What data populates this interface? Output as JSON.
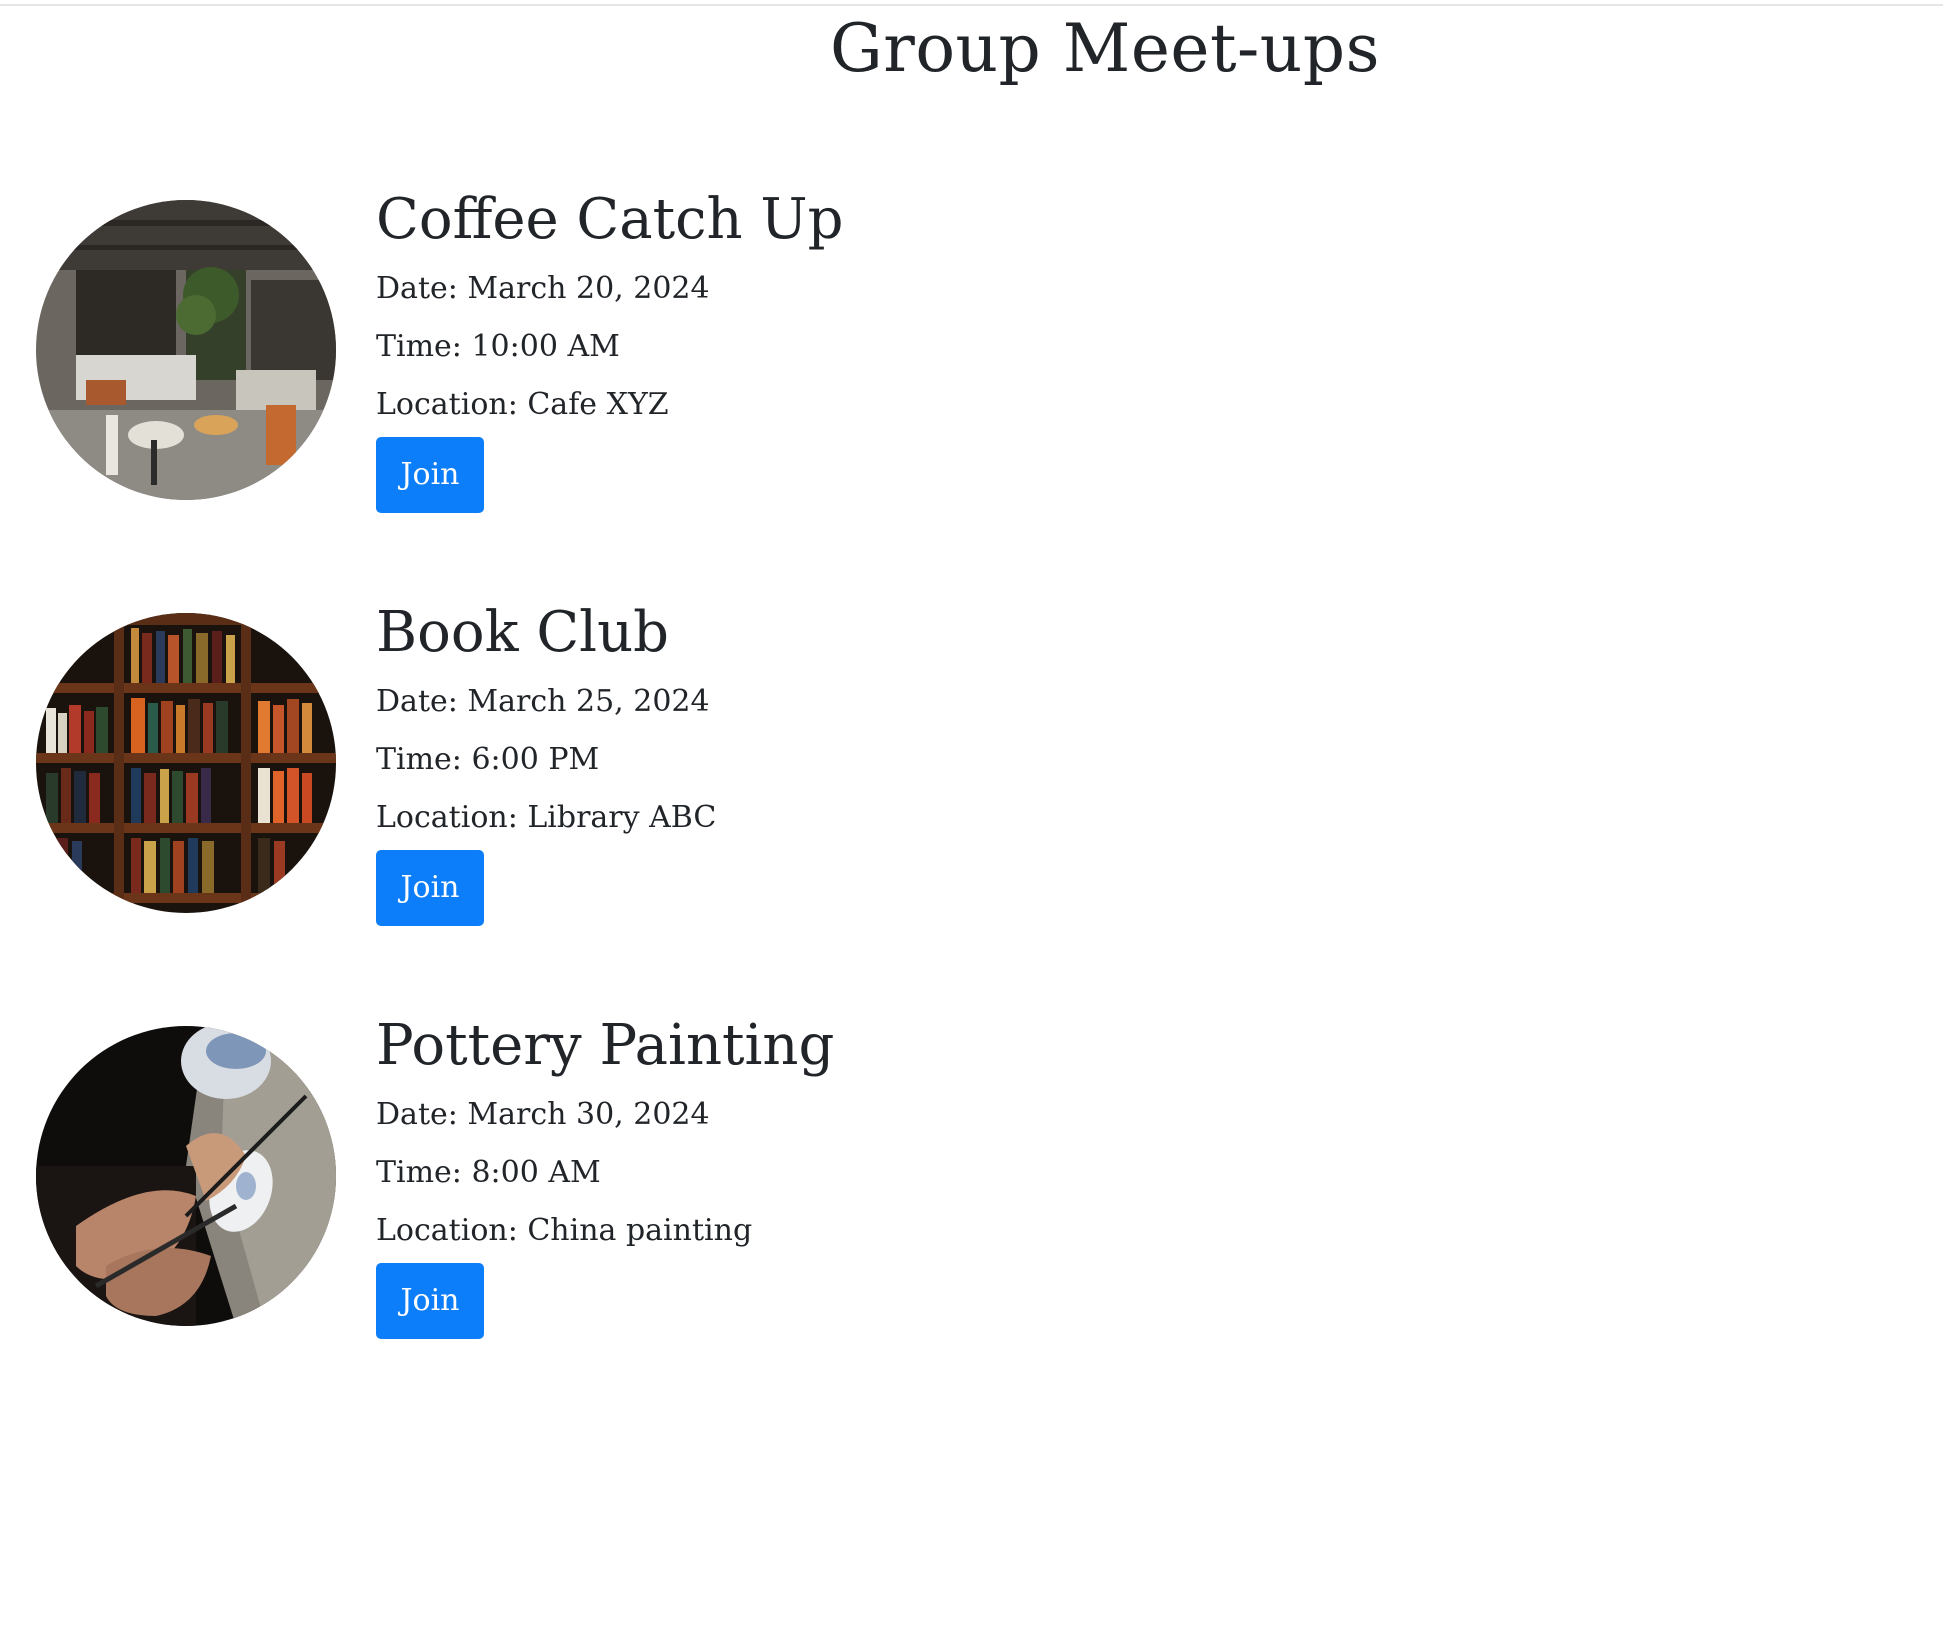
{
  "page": {
    "title": "Group Meet-ups"
  },
  "meetups": [
    {
      "title": "Coffee Catch Up",
      "date": "Date: March 20, 2024",
      "time": "Time: 10:00 AM",
      "location": "Location: Cafe XYZ",
      "button_label": "Join",
      "image": "cafe-interior-photo"
    },
    {
      "title": "Book Club",
      "date": "Date: March 25, 2024",
      "time": "Time: 6:00 PM",
      "location": "Location: Library ABC",
      "button_label": "Join",
      "image": "bookshelf-photo"
    },
    {
      "title": "Pottery Painting",
      "date": "Date: March 30, 2024",
      "time": "Time: 8:00 AM",
      "location": "Location: China painting",
      "button_label": "Join",
      "image": "pottery-painting-photo"
    }
  ],
  "colors": {
    "button_bg": "#0d7ef9",
    "text": "#212529"
  }
}
